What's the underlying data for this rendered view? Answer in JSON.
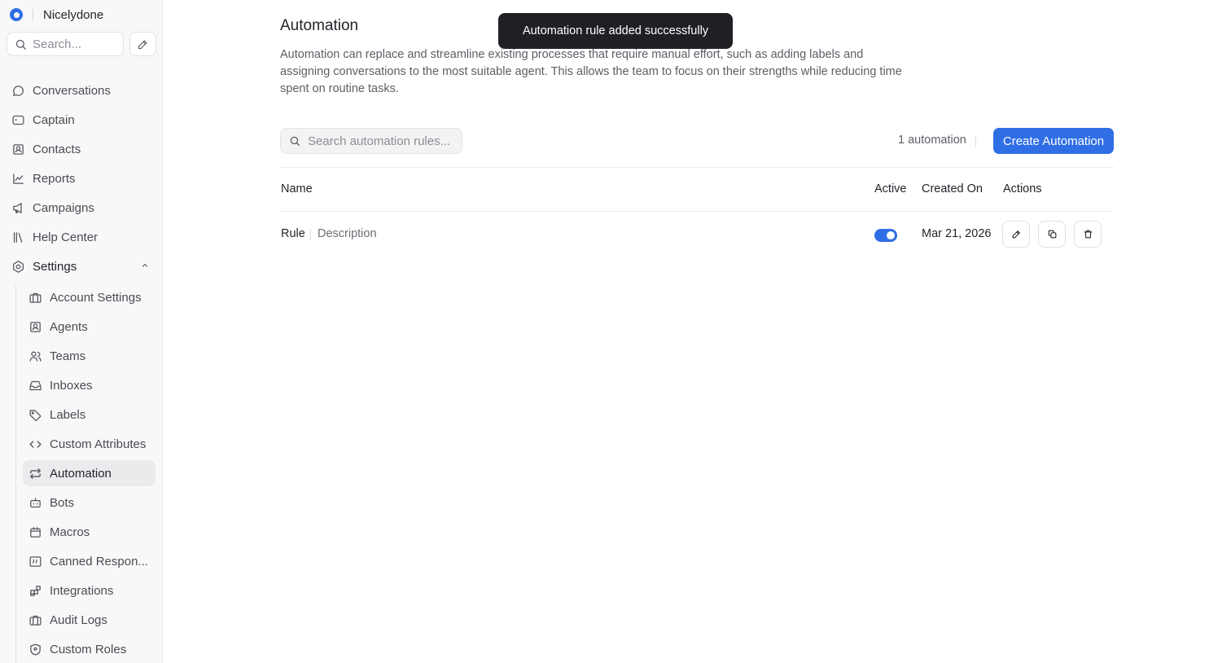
{
  "sidebar": {
    "brand_name": "Nicelydone",
    "search_placeholder": "Search...",
    "nav": [
      {
        "label": "Conversations",
        "icon": "chat-bubble-icon"
      },
      {
        "label": "Captain",
        "icon": "captain-icon"
      },
      {
        "label": "Contacts",
        "icon": "contacts-icon"
      },
      {
        "label": "Reports",
        "icon": "chart-icon"
      },
      {
        "label": "Campaigns",
        "icon": "megaphone-icon"
      },
      {
        "label": "Help Center",
        "icon": "library-icon"
      }
    ],
    "settings": {
      "label": "Settings",
      "icon": "gear-icon",
      "expanded": true,
      "items": [
        {
          "label": "Account Settings",
          "icon": "briefcase-icon"
        },
        {
          "label": "Agents",
          "icon": "agent-icon"
        },
        {
          "label": "Teams",
          "icon": "users-icon"
        },
        {
          "label": "Inboxes",
          "icon": "inbox-icon"
        },
        {
          "label": "Labels",
          "icon": "tag-icon"
        },
        {
          "label": "Custom Attributes",
          "icon": "code-icon"
        },
        {
          "label": "Automation",
          "icon": "repeat-icon",
          "active": true
        },
        {
          "label": "Bots",
          "icon": "bot-icon"
        },
        {
          "label": "Macros",
          "icon": "calendar-icon"
        },
        {
          "label": "Canned Respon...",
          "icon": "quote-icon"
        },
        {
          "label": "Integrations",
          "icon": "apps-icon"
        },
        {
          "label": "Audit Logs",
          "icon": "briefcase-icon"
        },
        {
          "label": "Custom Roles",
          "icon": "shield-icon"
        }
      ]
    }
  },
  "main": {
    "title": "Automation",
    "description": "Automation can replace and streamline existing processes that require manual effort, such as adding labels and assigning conversations to the most suitable agent. This allows the team to focus on their strengths while reducing time spent on routine tasks.",
    "search_placeholder": "Search automation rules...",
    "count_label": "1 automation",
    "create_button": "Create Automation",
    "table": {
      "headers": {
        "name": "Name",
        "active": "Active",
        "created_on": "Created On",
        "actions": "Actions"
      },
      "rows": [
        {
          "name": "Rule",
          "description": "Description",
          "active": true,
          "created_on": "Mar 21, 2026"
        }
      ]
    }
  },
  "toast": {
    "message": "Automation rule added successfully"
  },
  "colors": {
    "accent": "#2f6ee5",
    "toast_bg": "#1e2024",
    "active_item_bg": "#ebebed"
  }
}
